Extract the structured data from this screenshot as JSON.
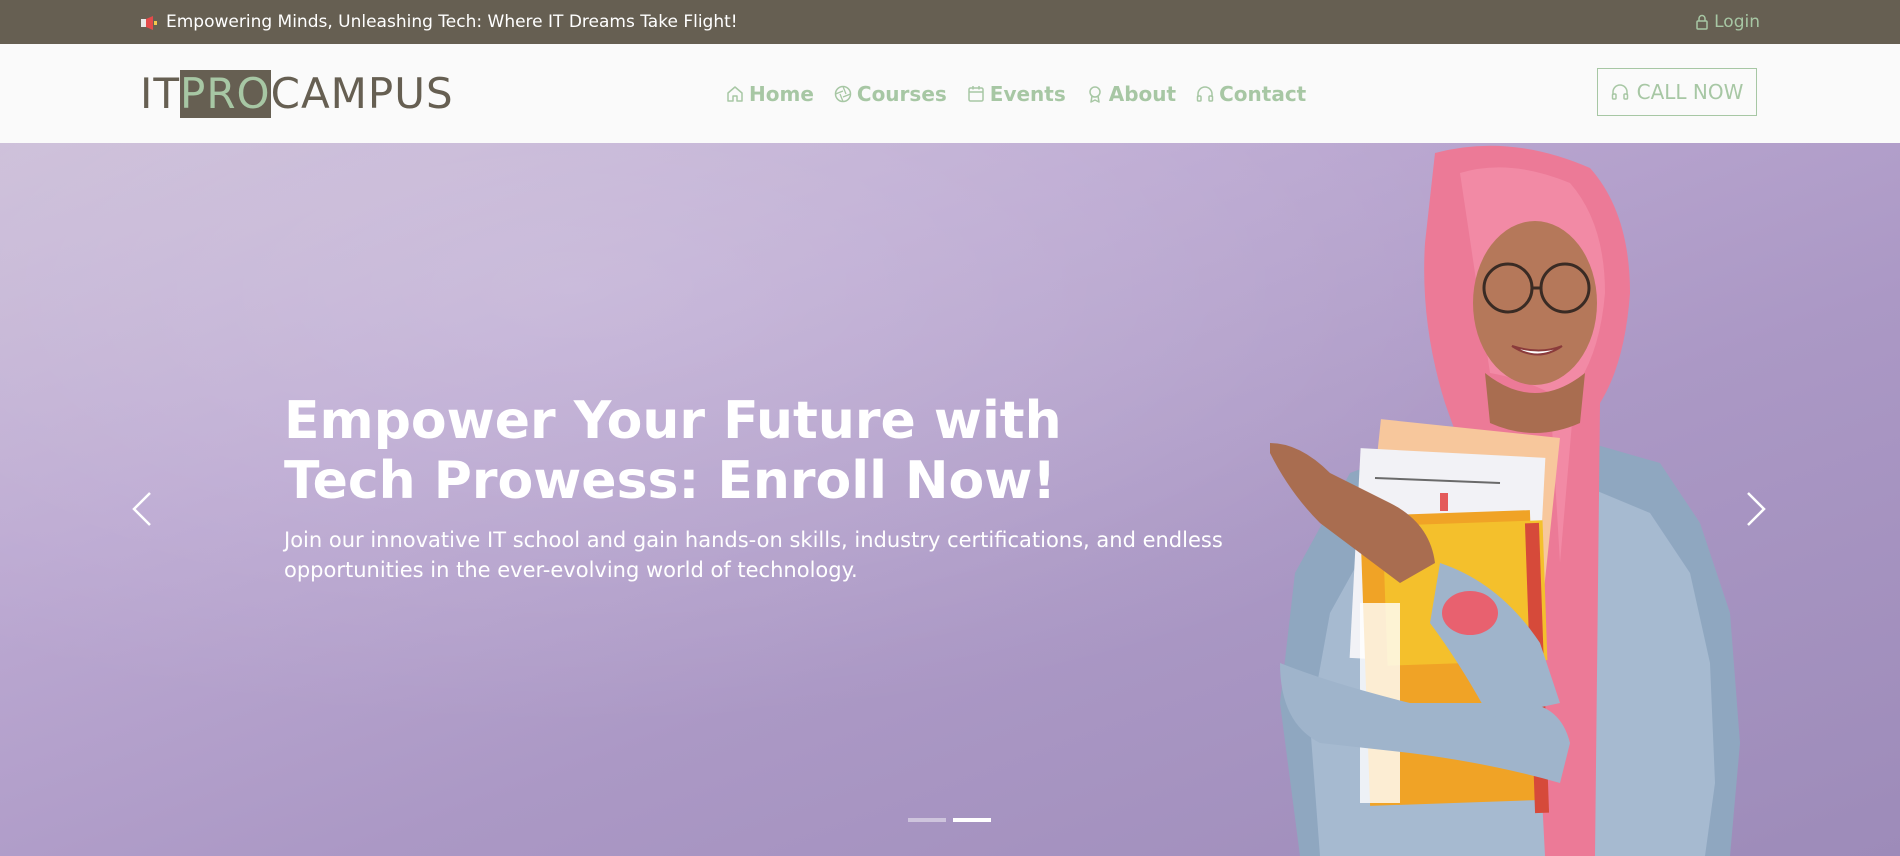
{
  "topbar": {
    "announcement": "Empowering Minds, Unleashing Tech: Where IT Dreams Take Flight!",
    "login_label": "Login",
    "icons": {
      "megaphone": "megaphone-icon",
      "login": "lock-icon"
    }
  },
  "logo": {
    "part1": "IT",
    "part2": "PRO",
    "part3": "CAMPUS"
  },
  "nav": {
    "items": [
      {
        "label": "Home",
        "icon": "home-icon"
      },
      {
        "label": "Courses",
        "icon": "aperture-icon"
      },
      {
        "label": "Events",
        "icon": "calendar-icon"
      },
      {
        "label": "About",
        "icon": "award-icon"
      },
      {
        "label": "Contact",
        "icon": "headphones-icon"
      }
    ],
    "call_label": "CALL NOW"
  },
  "hero": {
    "headline": "Empower Your Future with Tech Prowess: Enroll Now!",
    "subtext": "Join our innovative IT school and gain hands-on skills, industry certifications, and endless opportunities in the ever-evolving world of technology.",
    "slides_total": 2,
    "active_slide": 2
  },
  "colors": {
    "topbar_bg": "#665f52",
    "accent_green": "#a7c7a4",
    "hero_bg": "#b5a3cd",
    "white": "#ffffff"
  }
}
